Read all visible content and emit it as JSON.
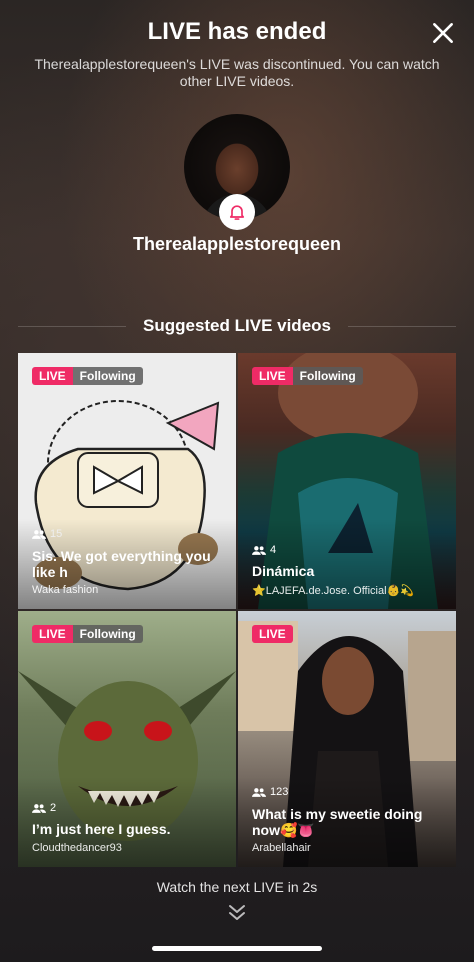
{
  "header": {
    "title": "LIVE has ended",
    "subtitle": "Therealapplestorequeen's LIVE was discontinued. You can watch other LIVE videos."
  },
  "host": {
    "username": "Therealapplestorequeen"
  },
  "section_title": "Suggested LIVE videos",
  "cards": [
    {
      "live": "LIVE",
      "following": "Following",
      "viewers": "15",
      "title": "Sis. We got everything you like h",
      "host": "Waka fashion"
    },
    {
      "live": "LIVE",
      "following": "Following",
      "viewers": "4",
      "title": "Dinámica",
      "host": "⭐LAJEFA.de.Jose. Official👶💫"
    },
    {
      "live": "LIVE",
      "following": "Following",
      "viewers": "2",
      "title": "I’m just here I guess.",
      "host": "Cloudthedancer93"
    },
    {
      "live": "LIVE",
      "viewers": "123",
      "title": "What is my sweetie doing now🥰👅",
      "host": "Arabellahair"
    }
  ],
  "footer": {
    "next_text": "Watch the next LIVE in 2s"
  },
  "icons": [
    "close-icon",
    "bell-icon",
    "viewers-icon",
    "double-chevron-down-icon"
  ]
}
